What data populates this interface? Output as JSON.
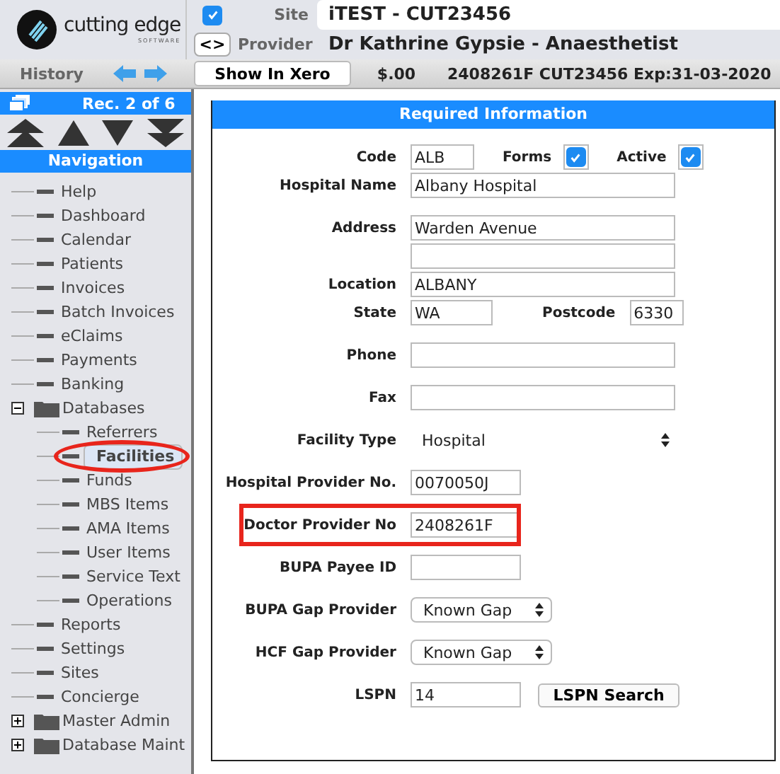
{
  "header": {
    "logo": {
      "name": "cutting edge",
      "tagline": "SOFTWARE"
    },
    "site_checkbox": {
      "checked": true
    },
    "site_label": "Site",
    "site_value": "iTEST - CUT23456",
    "swap_button": "<>",
    "provider_label": "Provider",
    "provider_value": "Dr Kathrine Gypsie - Anaesthetist",
    "history_label": "History",
    "xero_button": "Show In Xero",
    "amount": "$.00",
    "provider_info": "2408261F CUT23456 Exp:31-03-2020"
  },
  "sidebar": {
    "record": "Rec. 2 of 6",
    "nav_title": "Navigation",
    "tree": [
      {
        "label": "Help",
        "selected": false
      },
      {
        "label": "Dashboard",
        "selected": false
      },
      {
        "label": "Calendar",
        "selected": false
      },
      {
        "label": "Patients",
        "selected": false
      },
      {
        "label": "Invoices",
        "selected": false
      },
      {
        "label": "Batch Invoices",
        "selected": false
      },
      {
        "label": "eClaims",
        "selected": false
      },
      {
        "label": "Payments",
        "selected": false
      },
      {
        "label": "Banking",
        "selected": false
      },
      {
        "label": "Databases",
        "selected": false,
        "expanded": true,
        "children": [
          {
            "label": "Referrers",
            "selected": false
          },
          {
            "label": "Facilities",
            "selected": true,
            "circled": true
          },
          {
            "label": "Funds",
            "selected": false
          },
          {
            "label": "MBS Items",
            "selected": false
          },
          {
            "label": "AMA Items",
            "selected": false
          },
          {
            "label": "User Items",
            "selected": false
          },
          {
            "label": "Service Text",
            "selected": false
          },
          {
            "label": "Operations",
            "selected": false
          }
        ]
      },
      {
        "label": "Reports",
        "selected": false
      },
      {
        "label": "Settings",
        "selected": false
      },
      {
        "label": "Sites",
        "selected": false
      },
      {
        "label": "Concierge",
        "selected": false
      },
      {
        "label": "Master Admin",
        "selected": false,
        "expanded": false
      },
      {
        "label": "Database Maint",
        "selected": false,
        "expanded": false
      }
    ]
  },
  "form": {
    "title": "Required Information",
    "fields": [
      {
        "kind": "code",
        "label": "Code",
        "value": "ALB",
        "checks": [
          {
            "label": "Forms",
            "checked": true
          },
          {
            "label": "Active",
            "checked": true
          }
        ]
      },
      {
        "kind": "text",
        "label": "Hospital Name",
        "value": "Albany Hospital"
      },
      {
        "kind": "text",
        "label": "Address",
        "value": "Warden Avenue"
      },
      {
        "kind": "text"
      },
      {
        "kind": "text",
        "label": "Location",
        "value": "ALBANY"
      },
      {
        "kind": "pair",
        "label": "State",
        "value": "WA",
        "label2": "Postcode",
        "value2": "6330"
      },
      {
        "kind": "text",
        "label": "Phone"
      },
      {
        "kind": "text",
        "label": "Fax"
      },
      {
        "kind": "plain-select",
        "label": "Facility Type",
        "value": "Hospital"
      },
      {
        "kind": "text",
        "label": "Hospital Provider No.",
        "value": "0070050J"
      },
      {
        "kind": "text",
        "label": "Doctor Provider No",
        "value": "2408261F",
        "highlighted": true
      },
      {
        "kind": "text",
        "label": "BUPA Payee ID"
      },
      {
        "kind": "select",
        "label": "BUPA Gap Provider",
        "value": "Known Gap"
      },
      {
        "kind": "select",
        "label": "HCF Gap Provider",
        "value": "Known Gap"
      },
      {
        "kind": "search",
        "label": "LSPN",
        "value": "14",
        "button": "LSPN Search"
      }
    ]
  }
}
